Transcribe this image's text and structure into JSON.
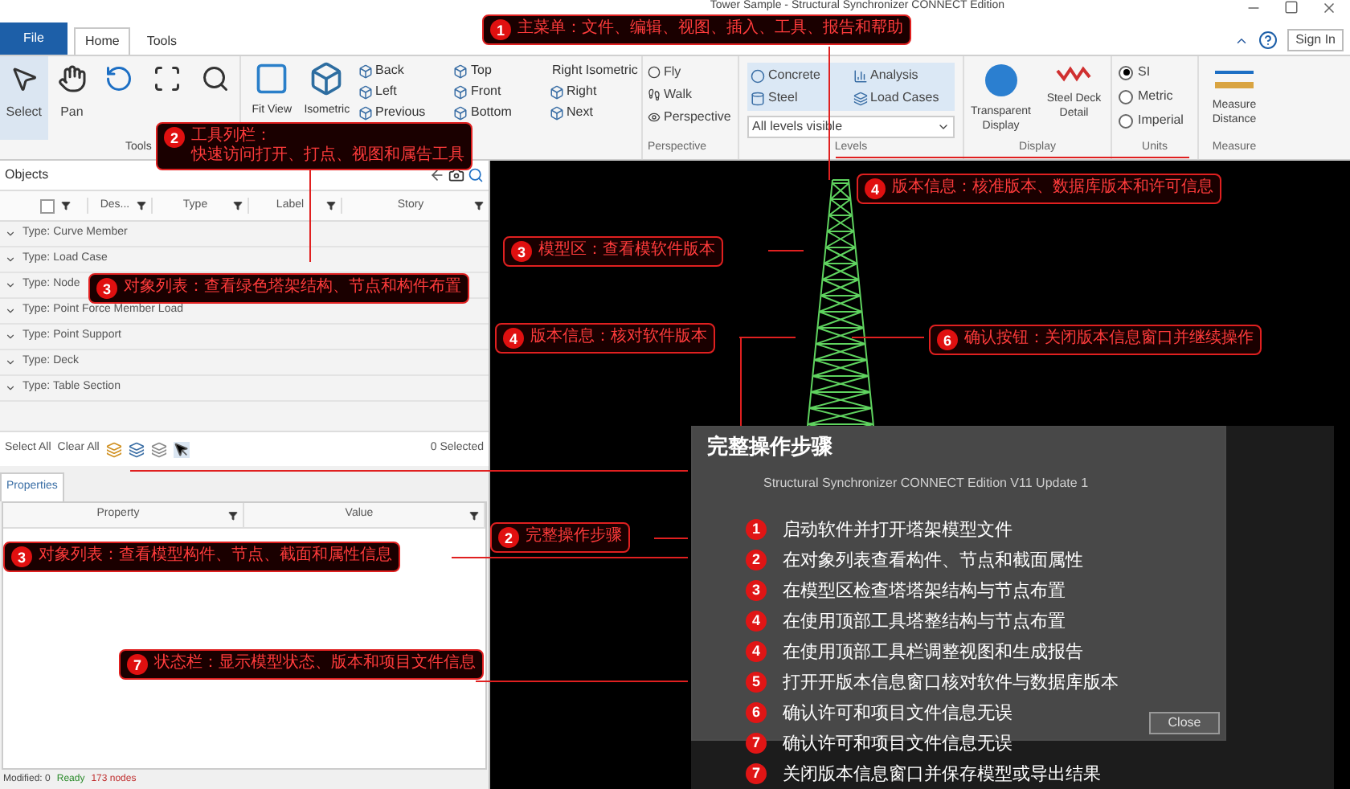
{
  "window": {
    "title": "Tower Sample - Structural Synchronizer CONNECT Edition"
  },
  "menu_tabs": [
    {
      "label": "File",
      "selected": false,
      "kind": "file"
    },
    {
      "label": "Home",
      "selected": true,
      "kind": "tab"
    },
    {
      "label": "Tools",
      "selected": false,
      "kind": "tab"
    }
  ],
  "sign_in": "Sign In",
  "ribbon": {
    "tools": {
      "label": "Tools",
      "buttons": [
        {
          "label": "Select",
          "selected": true,
          "kind": "select"
        },
        {
          "label": "Pan",
          "selected": false,
          "kind": "pan"
        },
        {
          "selected": false,
          "kind": "rotate"
        },
        {
          "selected": false,
          "kind": "frame"
        },
        {
          "selected": false,
          "kind": "zoom"
        }
      ]
    },
    "view": {
      "large": [
        "Fit View",
        "Isometric"
      ],
      "small": [
        "Back",
        "Left",
        "Previous",
        "Top",
        "Front",
        "Bottom",
        "Right Isometric",
        "Right",
        "Next"
      ]
    },
    "perspective": {
      "label": "Perspective",
      "items": [
        "Fly",
        "Walk",
        "Perspective"
      ]
    },
    "levels": {
      "label": "Levels",
      "items": [
        {
          "label": "Concrete",
          "kind": "concrete"
        },
        {
          "label": "Steel",
          "kind": "steel"
        },
        {
          "label": "Analysis",
          "kind": "analysis"
        },
        {
          "label": "Load Cases",
          "kind": "load"
        }
      ],
      "dropdown": "All levels visible"
    },
    "display": {
      "label": "Display",
      "buttons": [
        {
          "label": "Transparent Display",
          "kind": "sphere"
        },
        {
          "label": "Steel Deck Detail",
          "kind": "wave"
        }
      ]
    },
    "units": {
      "label": "Units",
      "options": [
        {
          "label": "SI",
          "selected": true
        },
        {
          "label": "Metric",
          "selected": false
        },
        {
          "label": "Imperial",
          "selected": false
        }
      ]
    },
    "measure": {
      "label": "Measure",
      "button": "Measure Distance"
    }
  },
  "objects": {
    "title": "Objects",
    "header_checkbox": {
      "checked": false
    },
    "columns": [
      "Des...",
      "Type",
      "Label",
      "Story"
    ],
    "groups": [
      "Type: Curve Member",
      "Type: Load Case",
      "Type: Node",
      "Type: Point Force Member Load",
      "Type: Point Support",
      "Type: Deck",
      "Type: Table Section"
    ],
    "select_all": "Select All",
    "clear_all": "Clear All",
    "selected_count": "0 Selected"
  },
  "properties": {
    "tab": "Properties",
    "columns": [
      "Property",
      "Value"
    ]
  },
  "status_bar": [
    "Modified: 0",
    "Ready",
    "173 nodes"
  ],
  "about_dialog": {
    "product": "Structural Synchronizer CONNECT Edition V11 Update 1",
    "close": "Close"
  },
  "steps_panel": {
    "title": "完整操作步骤",
    "steps": [
      {
        "number": "1",
        "text": "启动软件并打开塔架模型文件"
      },
      {
        "number": "2",
        "text": "在对象列表查看构件、节点和截面属性"
      },
      {
        "number": "3",
        "text": "在模型区检查塔塔架结构与节点布置"
      },
      {
        "number": "4",
        "text": "在使用顶部工具塔整结构与节点布置"
      },
      {
        "number": "4",
        "text": "在使用顶部工具栏调整视图和生成报告"
      },
      {
        "number": "5",
        "text": "打开开版本信息窗口核对软件与数据库版本"
      },
      {
        "number": "6",
        "text": "确认许可和项目文件信息无误"
      },
      {
        "number": "7",
        "text": "确认许可和项目文件信息无误"
      },
      {
        "number": "7",
        "text": "关闭版本信息窗口并保存模型或导出结果"
      }
    ]
  },
  "callouts": [
    {
      "number": "1",
      "lines": [
        "主菜单：文件、编辑、视图、插入、工具、报告和帮助"
      ]
    },
    {
      "number": "2",
      "lines": [
        "工具列栏：",
        "快速访问打开、打点、视图和属告工具"
      ]
    },
    {
      "number": "3",
      "lines": [
        "对象列表：查看绿色塔架结构、节点和构件布置"
      ]
    },
    {
      "number": "3",
      "lines": [
        "模型区：查看模软件版本"
      ]
    },
    {
      "number": "4",
      "lines": [
        "版本信息：核对软件版本"
      ]
    },
    {
      "number": "4",
      "lines": [
        "版本信息：核准版本、数据库版本和许可信息"
      ]
    },
    {
      "number": "6",
      "lines": [
        "确认按钮：关闭版本信息窗口并继续操作"
      ]
    },
    {
      "number": "2",
      "lines": [
        "完整操作步骤"
      ]
    },
    {
      "number": "3",
      "lines": [
        "对象列表：查看模型构件、节点、截面和属性信息"
      ]
    },
    {
      "number": "7",
      "lines": [
        "状态栏：显示模型状态、版本和项目文件信息"
      ]
    }
  ]
}
